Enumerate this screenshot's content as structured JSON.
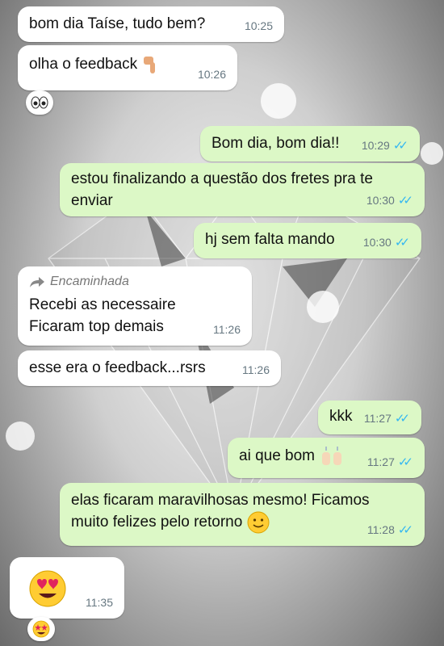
{
  "wallpaper": {
    "icon": "diamond-wallpaper",
    "colors": [
      "#f4f4f4",
      "#8e8e8e"
    ]
  },
  "colors": {
    "incoming": "#ffffff",
    "outgoing": "#dcf8c6",
    "read_ticks": "#34b7f1",
    "time": "#667781"
  },
  "messages": [
    {
      "dir": "in",
      "text": "bom dia Taíse, tudo bem?",
      "time": "10:25"
    },
    {
      "dir": "in",
      "text": "olha o feedback",
      "emoji": "backhand-index-pointing-down",
      "time": "10:26",
      "reaction": "eyes"
    },
    {
      "dir": "out",
      "text": "Bom dia, bom dia!!",
      "time": "10:29",
      "status": "read"
    },
    {
      "dir": "out",
      "line1": "estou finalizando a questão dos fretes pra te",
      "line2": "enviar",
      "time": "10:30",
      "status": "read"
    },
    {
      "dir": "out",
      "text": "hj sem falta mando",
      "time": "10:30",
      "status": "read"
    },
    {
      "dir": "in",
      "forwarded_label": "Encaminhada",
      "line1": "Recebi as necessaire",
      "line2": "Ficaram top demais",
      "time": "11:26"
    },
    {
      "dir": "in",
      "text": "esse era o feedback...rsrs",
      "time": "11:26"
    },
    {
      "dir": "out",
      "text": "kkk",
      "time": "11:27",
      "status": "read"
    },
    {
      "dir": "out",
      "text": "ai que bom",
      "emoji": "raising-hands",
      "time": "11:27",
      "status": "read"
    },
    {
      "dir": "out",
      "line1": "elas ficaram maravilhosas mesmo! Ficamos",
      "line2": "muito felizes pelo retorno",
      "emoji": "smiling-face",
      "time": "11:28",
      "status": "read"
    },
    {
      "dir": "in",
      "emoji": "heart-eyes",
      "time": "11:35",
      "reaction": "star-struck"
    }
  ]
}
